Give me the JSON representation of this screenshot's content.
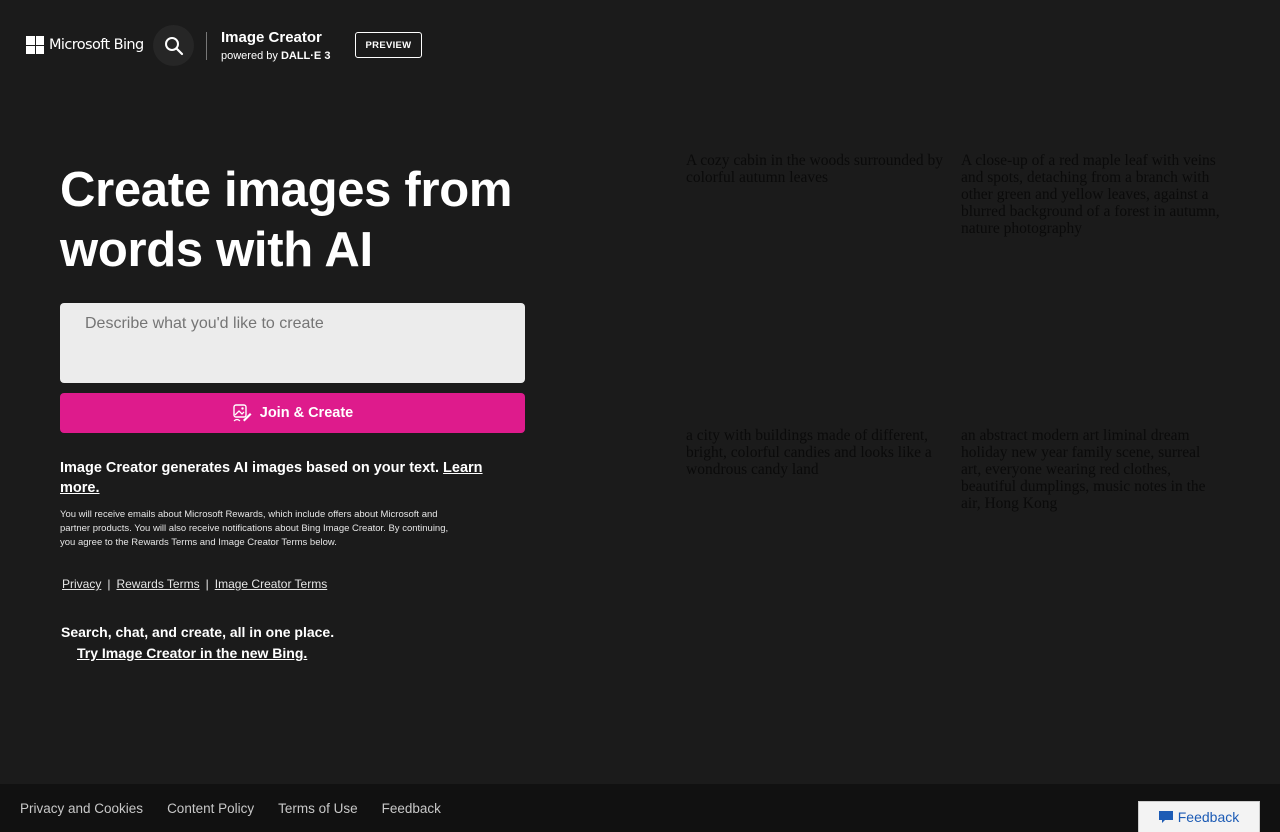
{
  "header": {
    "brand": "Microsoft Bing",
    "search_icon": "search-icon",
    "title": "Image Creator",
    "subtitle_prefix": "powered by ",
    "subtitle_model": "DALL·E 3",
    "badge": "PREVIEW"
  },
  "hero": {
    "title": "Create images from words with AI",
    "prompt_placeholder": "Describe what you'd like to create",
    "prompt_value": "",
    "create_button": "Join & Create",
    "create_icon": "image-pen-icon"
  },
  "info": {
    "text": "Image Creator generates AI images based on your text. ",
    "learn_more": "Learn more.",
    "legal": "You will receive emails about Microsoft Rewards, which include offers about Microsoft and partner products. You will also receive notifications about Bing Image Creator. By continuing, you agree to the Rewards Terms and Image Creator Terms below.",
    "links": [
      "Privacy",
      "Rewards Terms",
      "Image Creator Terms"
    ],
    "separator": "|"
  },
  "promo": {
    "line": "Search, chat, and create, all in one place.",
    "link": "Try Image Creator in the new Bing."
  },
  "gallery": [
    "A cozy cabin in the woods surrounded by colorful autumn leaves",
    "A close-up of a red maple leaf with veins and spots, detaching from a branch with other green and yellow leaves, against a blurred background of a forest in autumn, nature photography",
    "a city with buildings made of different, bright, colorful candies and looks like a wondrous candy land",
    "an abstract modern art liminal dream holiday new year family scene, surreal art, everyone wearing red clothes, beautiful dumplings, music notes in the air, Hong Kong"
  ],
  "footer": {
    "links": [
      "Privacy and Cookies",
      "Content Policy",
      "Terms of Use",
      "Feedback"
    ],
    "feedback_button": "Feedback"
  },
  "colors": {
    "background": "#1b1b1b",
    "accent": "#de1b8c",
    "footer": "#111111",
    "feedback_text": "#1c5bb5"
  }
}
